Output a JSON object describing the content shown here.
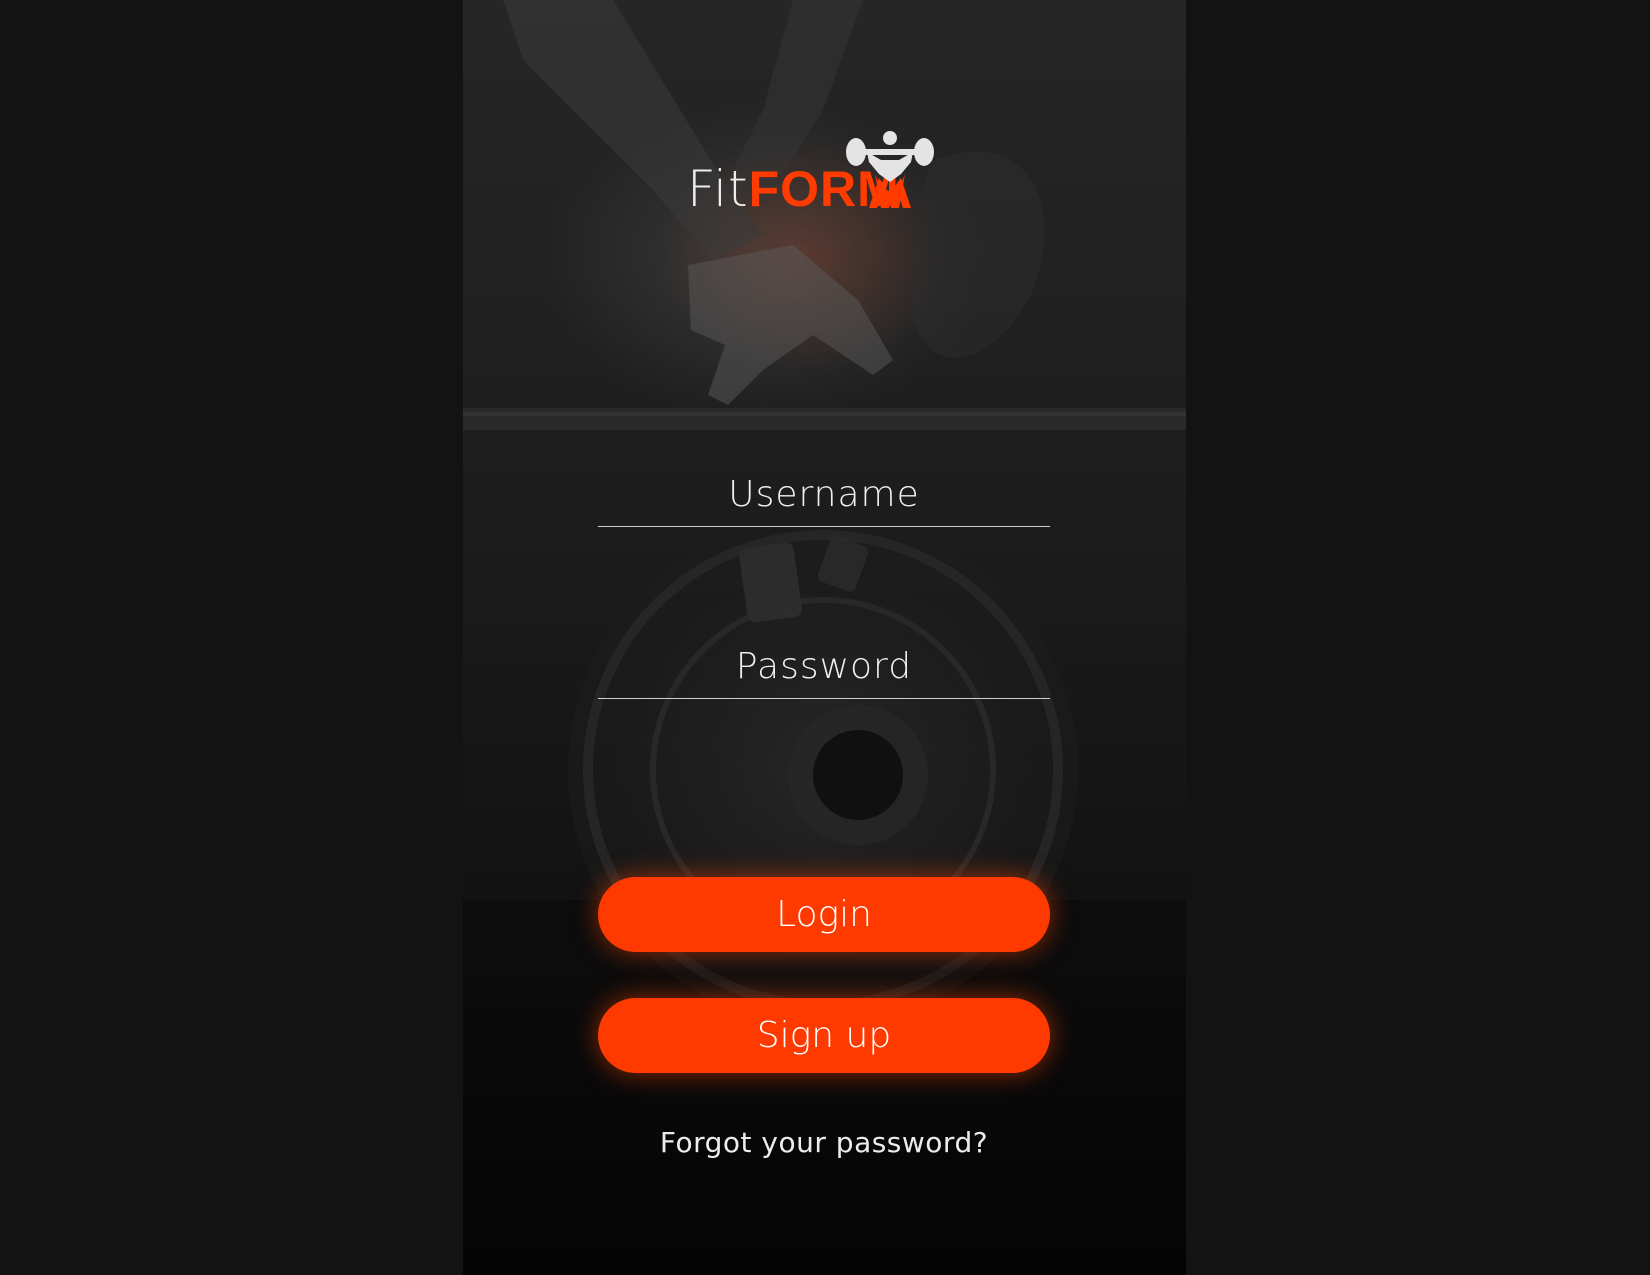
{
  "brand": {
    "name_part1": "Fit",
    "name_part2": "FORM",
    "icon": "weightlifter-icon",
    "accent_color": "#ff3a00"
  },
  "form": {
    "username_placeholder": "Username",
    "username_value": "",
    "password_placeholder": "Password",
    "password_value": ""
  },
  "buttons": {
    "login_label": "Login",
    "signup_label": "Sign up"
  },
  "links": {
    "forgot_password": "Forgot your password?"
  }
}
